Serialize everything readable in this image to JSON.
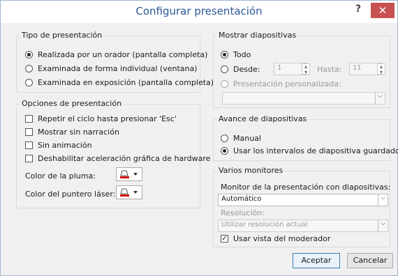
{
  "window": {
    "title": "Configurar presentación",
    "help": "?",
    "close": "✕"
  },
  "tipo": {
    "title": "Tipo de presentación",
    "options": [
      {
        "label": "Realizada por un orador (pantalla completa)",
        "selected": true
      },
      {
        "label": "Examinada de forma individual (ventana)",
        "selected": false
      },
      {
        "label": "Examinada en exposición (pantalla completa)",
        "selected": false
      }
    ]
  },
  "opciones": {
    "title": "Opciones de presentación",
    "checks": [
      {
        "label": "Repetir el ciclo hasta presionar 'Esc'",
        "checked": false
      },
      {
        "label": "Mostrar sin narración",
        "checked": false
      },
      {
        "label": "Sin animación",
        "checked": false
      },
      {
        "label": "Deshabilitar aceleración gráfica de hardware",
        "checked": false
      }
    ],
    "pen_color_label": "Color de la pluma:",
    "laser_color_label": "Color del puntero láser:"
  },
  "mostrar": {
    "title": "Mostrar diapositivas",
    "todo": "Todo",
    "desde": "Desde:",
    "desde_value": "1",
    "hasta": "Hasta:",
    "hasta_value": "11",
    "personalizada": "Presentación personalizada:"
  },
  "avance": {
    "title": "Avance de diapositivas",
    "manual": "Manual",
    "intervalos": "Usar los intervalos de diapositiva guardados"
  },
  "monitores": {
    "title": "Varios monitores",
    "monitor_label": "Monitor de la presentación con diapositivas:",
    "monitor_value": "Automático",
    "resolucion_label": "Resolución:",
    "resolucion_value": "Utilizar resolución actual",
    "vista_moderador": "Usar vista del moderador"
  },
  "buttons": {
    "ok": "Aceptar",
    "cancel": "Cancelar"
  },
  "colors": {
    "title": "#2b5797",
    "close_bg": "#c75050",
    "pen_red": "#d01010"
  }
}
